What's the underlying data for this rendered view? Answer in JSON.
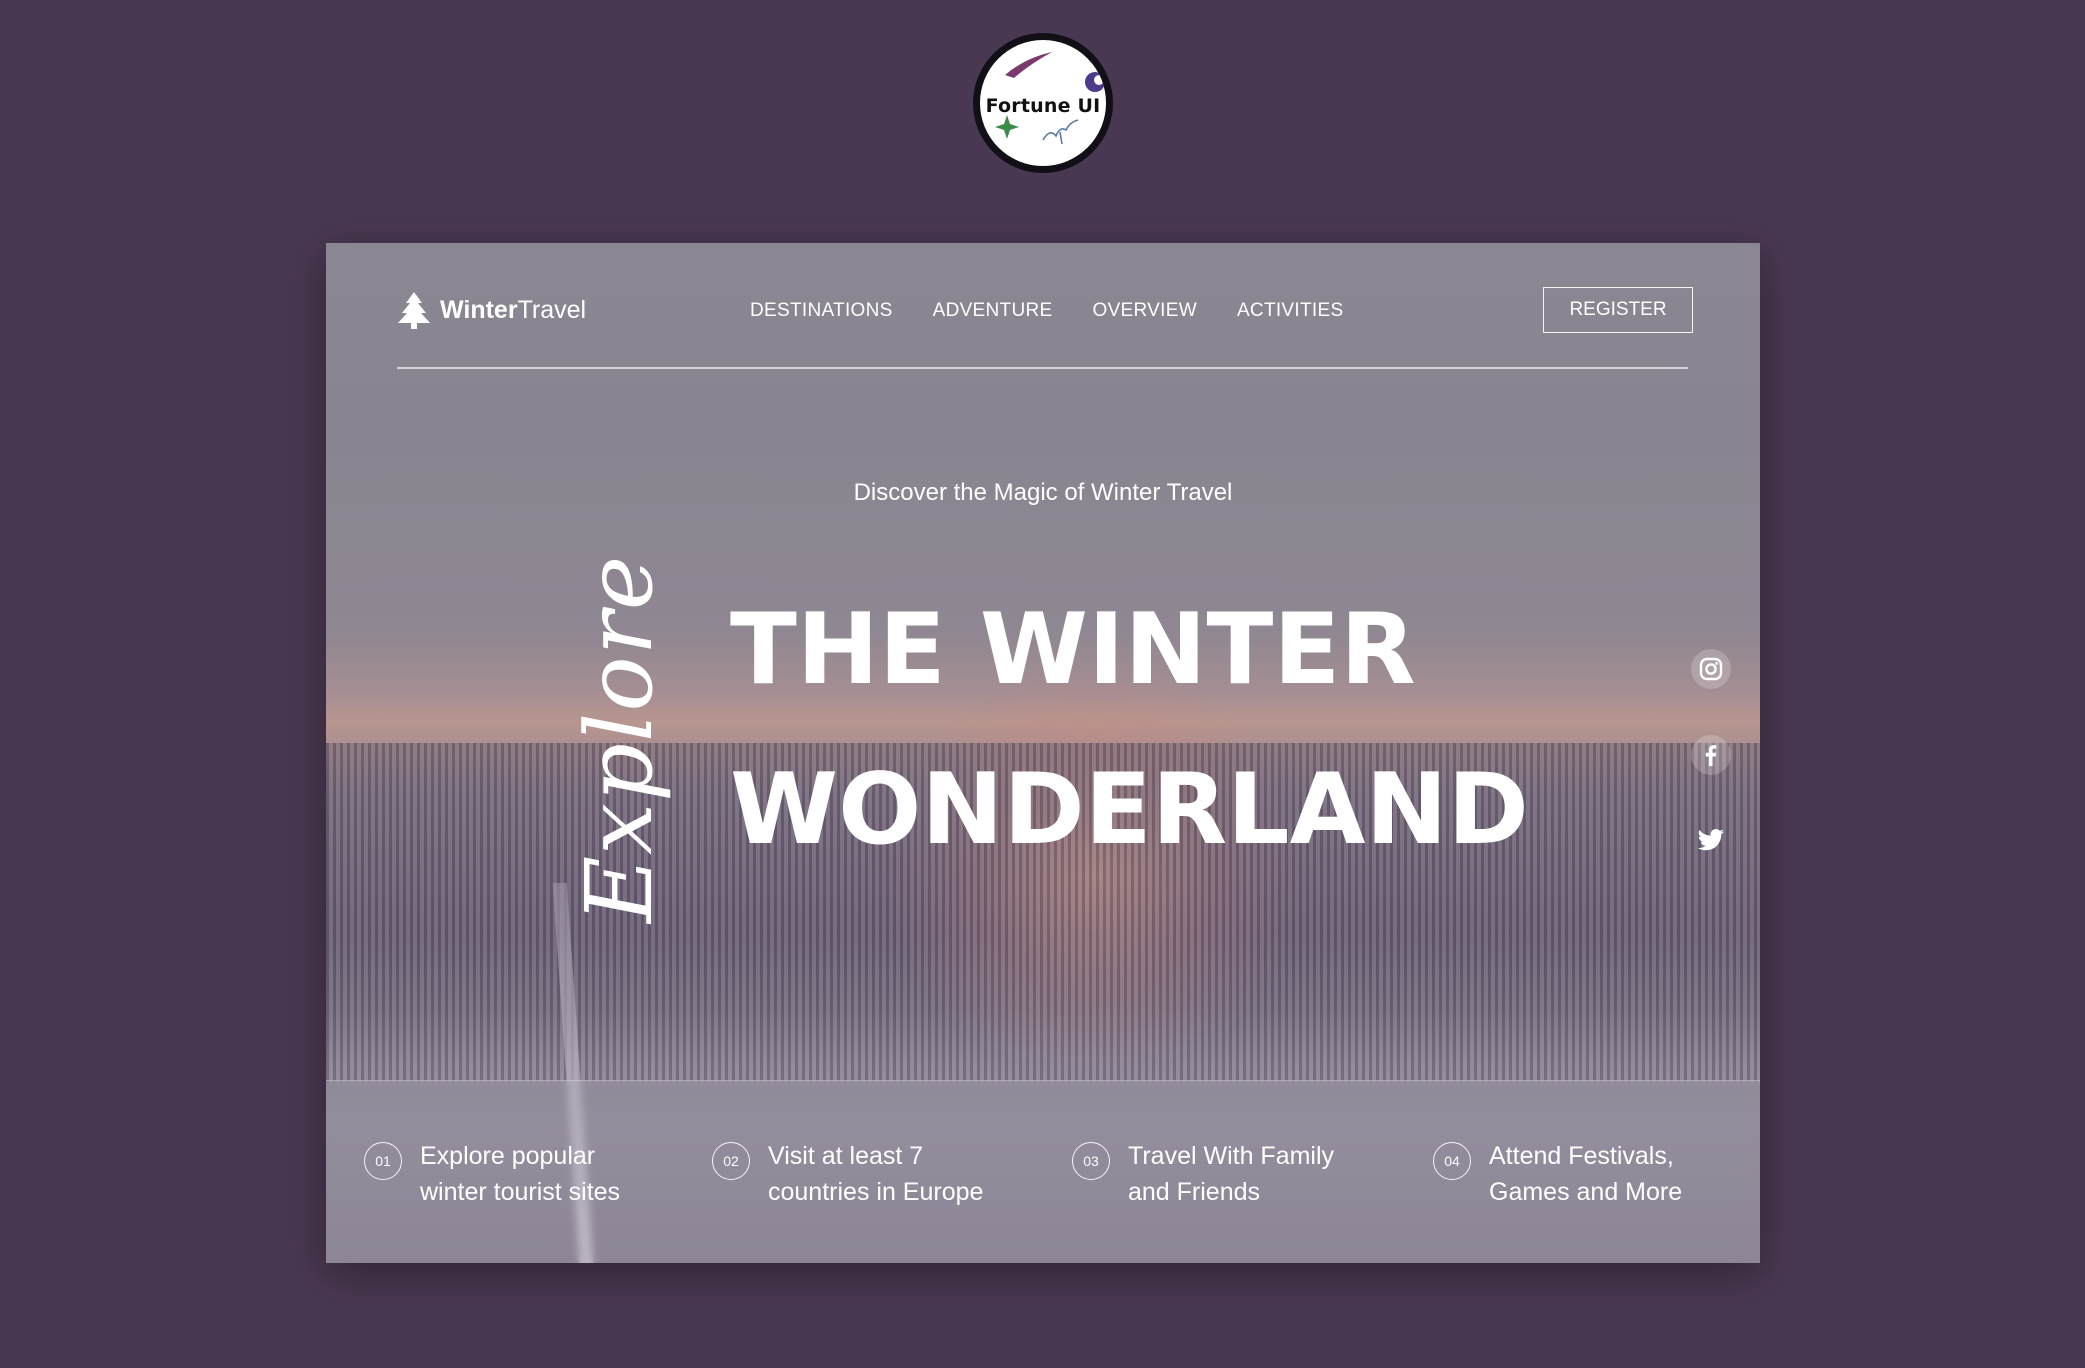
{
  "badge": {
    "label": "Fortune UI"
  },
  "brand": {
    "bold": "Winter",
    "light": "Travel"
  },
  "nav": {
    "links": [
      "DESTINATIONS",
      "ADVENTURE",
      "OVERVIEW",
      "ACTIVITIES"
    ],
    "register": "REGISTER"
  },
  "hero": {
    "subtitle": "Discover the Magic of Winter Travel",
    "script": "Explore",
    "line1": "THE WINTER",
    "line2": "WONDERLAND"
  },
  "social": {
    "icons": [
      "instagram-icon",
      "facebook-icon",
      "twitter-icon"
    ]
  },
  "features": [
    {
      "num": "01",
      "line1": "Explore popular",
      "line2": "winter tourist sites"
    },
    {
      "num": "02",
      "line1": "Visit at least 7",
      "line2": "countries in Europe"
    },
    {
      "num": "03",
      "line1": "Travel With Family",
      "line2": "and Friends"
    },
    {
      "num": "04",
      "line1": "Attend Festivals,",
      "line2": "Games and More"
    }
  ],
  "colors": {
    "background": "#493851",
    "text": "#ffffff"
  }
}
